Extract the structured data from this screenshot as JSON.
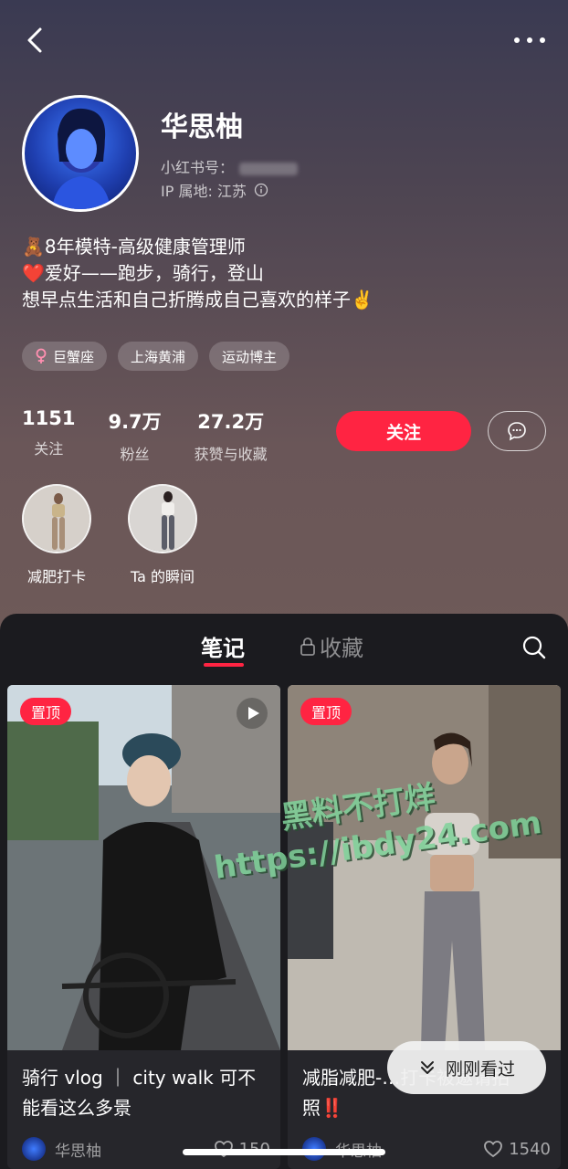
{
  "profile": {
    "name": "华思柚",
    "redbook_label": "小红书号：",
    "ip_label": "IP 属地: 江苏",
    "bio_lines": [
      "🧸8年模特-高级健康管理师",
      "❤️爱好——跑步，骑行，登山",
      "想早点生活和自己折腾成自己喜欢的样子✌️"
    ]
  },
  "tags": [
    {
      "icon": "female-icon",
      "label": "巨蟹座"
    },
    {
      "label": "上海黄浦"
    },
    {
      "label": "运动博主"
    }
  ],
  "stats": [
    {
      "num": "1151",
      "label": "关注"
    },
    {
      "num": "9.7万",
      "label": "粉丝"
    },
    {
      "num": "27.2万",
      "label": "获赞与收藏"
    }
  ],
  "actions": {
    "follow": "关注"
  },
  "highlights": [
    {
      "label": "减肥打卡"
    },
    {
      "label": "Ta 的瞬间"
    }
  ],
  "tabs": {
    "notes": "笔记",
    "collect": "收藏"
  },
  "notes": [
    {
      "pin": "置顶",
      "title": "骑行 vlog ｜ city walk 可不能看这么多景",
      "author": "华思柚",
      "likes": "150",
      "video": true
    },
    {
      "pin": "置顶",
      "title": "减脂减肥-…打卡被邀请拍照‼️",
      "author": "华思柚",
      "likes": "1540",
      "video": false
    }
  ],
  "recent_button": "刚刚看过",
  "watermark": {
    "line1": "黑料不打烊",
    "line2": "https://ibdy24.com"
  },
  "colors": {
    "accent": "#ff2442",
    "content_bg": "#1b1b1f"
  }
}
